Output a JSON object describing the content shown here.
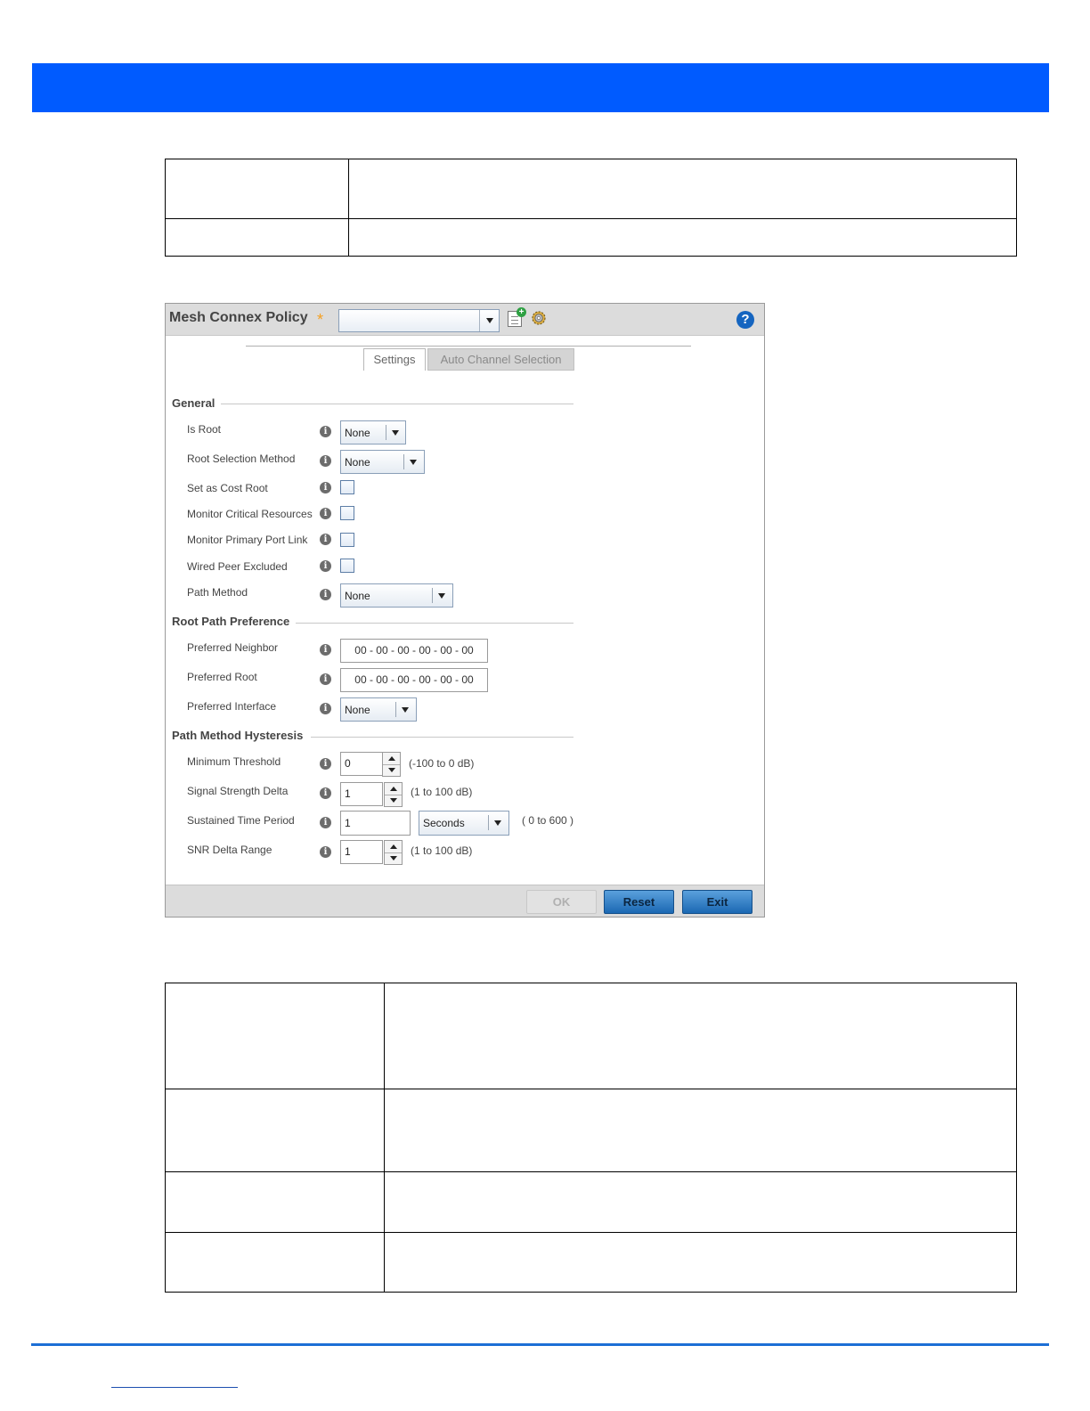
{
  "colors": {
    "header_bar": "#005bff",
    "primary_button": "#1b68b3",
    "help_icon": "#1565c0",
    "required_star": "#f5a020"
  },
  "dialog": {
    "title": "Mesh Connex Policy",
    "required_mark": "*",
    "policy_select_value": "",
    "help_glyph": "?",
    "tabs": [
      {
        "label": "Settings",
        "active": true
      },
      {
        "label": "Auto Channel Selection",
        "active": false
      }
    ],
    "general": {
      "heading": "General",
      "is_root": {
        "label": "Is Root",
        "value": "None"
      },
      "root_selection_method": {
        "label": "Root Selection Method",
        "value": "None"
      },
      "set_as_cost_root": {
        "label": "Set as Cost Root",
        "checked": false
      },
      "monitor_critical_resources": {
        "label": "Monitor Critical Resources",
        "checked": false
      },
      "monitor_primary_port_link": {
        "label": "Monitor Primary Port Link",
        "checked": false
      },
      "wired_peer_excluded": {
        "label": "Wired Peer Excluded",
        "checked": false
      },
      "path_method": {
        "label": "Path Method",
        "value": "None"
      }
    },
    "root_path_preference": {
      "heading": "Root Path Preference",
      "preferred_neighbor": {
        "label": "Preferred  Neighbor",
        "value": "00 - 00 - 00 - 00 - 00 - 00"
      },
      "preferred_root": {
        "label": "Preferred Root",
        "value": "00 - 00 - 00 - 00 - 00 - 00"
      },
      "preferred_interface": {
        "label": "Preferred Interface",
        "value": "None"
      }
    },
    "path_method_hysteresis": {
      "heading": "Path Method Hysteresis",
      "minimum_threshold": {
        "label": "Minimum Threshold",
        "value": "0",
        "range": "(-100 to 0 dB)"
      },
      "signal_strength_delta": {
        "label": "Signal Strength Delta",
        "value": "1",
        "range": "(1 to 100 dB)"
      },
      "sustained_time_period": {
        "label": "Sustained Time Period",
        "value": "1",
        "unit": "Seconds",
        "range": "( 0 to 600 )"
      },
      "snr_delta_range": {
        "label": "SNR Delta Range",
        "value": "1",
        "range": "(1 to 100 dB)"
      }
    },
    "buttons": {
      "ok": "OK",
      "reset": "Reset",
      "exit": "Exit"
    }
  }
}
